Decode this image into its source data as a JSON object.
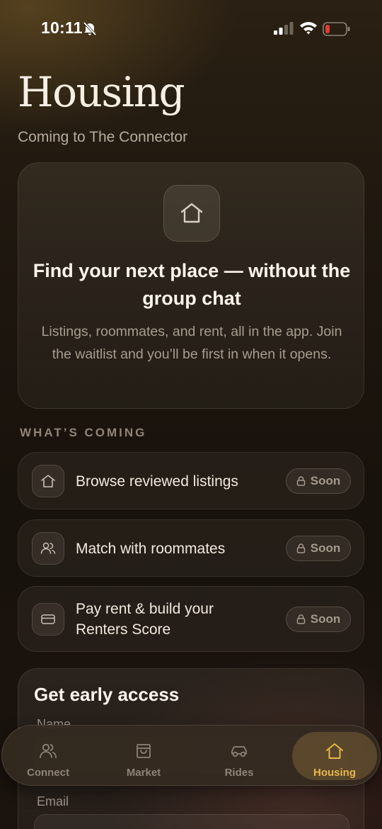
{
  "status_bar": {
    "time": "10:11",
    "icons": [
      "bell-slash-icon",
      "signal-icon",
      "wifi-icon",
      "battery-low-icon"
    ],
    "battery_color": "#e03a3a"
  },
  "header": {
    "title": "Housing",
    "subtitle": "Coming to The Connector"
  },
  "hero": {
    "icon": "house-icon",
    "title": "Find your next place — without the group chat",
    "description": "Listings, roommates, and rent, all in the app. Join the waitlist and you’ll be first in when it opens."
  },
  "features": {
    "section_label": "WHAT’S COMING",
    "items": [
      {
        "icon": "house-icon",
        "label": "Browse reviewed listings",
        "badge": "Soon"
      },
      {
        "icon": "people-icon",
        "label": "Match with roommates",
        "badge": "Soon"
      },
      {
        "icon": "card-icon",
        "label": "Pay rent & build your Renters Score",
        "badge": "Soon"
      }
    ]
  },
  "early_access": {
    "title": "Get early access",
    "name_label": "Name",
    "email_label": "Email"
  },
  "tab_bar": {
    "tabs": [
      {
        "label": "Connect",
        "icon": "people-icon"
      },
      {
        "label": "Market",
        "icon": "store-icon"
      },
      {
        "label": "Rides",
        "icon": "car-icon"
      },
      {
        "label": "Housing",
        "icon": "house-icon",
        "active": true
      }
    ],
    "active_color": "#e8b64a"
  }
}
